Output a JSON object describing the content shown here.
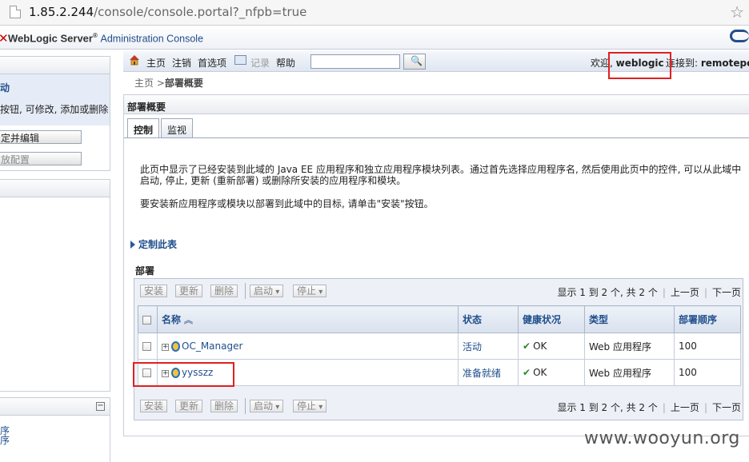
{
  "browser": {
    "url_host": "1.85.2.244",
    "url_path": "/console/console.portal?_nfpb=true"
  },
  "header": {
    "brand": "WebLogic Server",
    "brand_mark": "®",
    "subtitle": "Administration Console"
  },
  "left": {
    "change_center_title": "动",
    "change_center_text": "按钮, 可修改, 添加或删除",
    "lock_edit_button": "定并编辑",
    "release_config_button": "放配置",
    "bottom_items": [
      "序",
      "序"
    ]
  },
  "toolbar": {
    "home": "主页",
    "logout": "注销",
    "preferences": "首选项",
    "record": "记录",
    "help": "帮助",
    "search_placeholder": "",
    "welcome_prefix": "欢迎,",
    "username": "weblogic",
    "connected_prefix": "连接到:",
    "domain": "remotepc"
  },
  "breadcrumb": {
    "home": "主页",
    "sep": ">",
    "current": "部署概要"
  },
  "panel": {
    "title": "部署概要",
    "tabs": [
      {
        "label": "控制",
        "active": true
      },
      {
        "label": "监视",
        "active": false
      }
    ],
    "desc1": "此页中显示了已经安装到此域的 Java EE 应用程序和独立应用程序模块列表。通过首先选择应用程序名, 然后使用此页中的控件, 可以从此域中启动, 停止, 更新 (重新部署) 或删除所安装的应用程序和模块。",
    "desc2": "要安装新应用程序或模块以部署到此域中的目标, 请单击\"安装\"按钮。",
    "customize": "定制此表",
    "section": "部署"
  },
  "table": {
    "buttons": {
      "install": "安装",
      "update": "更新",
      "delete": "删除",
      "start": "启动",
      "stop": "停止"
    },
    "pager": {
      "text": "显示 1 到 2 个, 共 2 个",
      "prev": "上一页",
      "next": "下一页"
    },
    "columns": [
      "名称",
      "状态",
      "健康状况",
      "类型",
      "部署顺序"
    ],
    "rows": [
      {
        "name": "OC_Manager",
        "state": "活动",
        "health": "OK",
        "type": "Web 应用程序",
        "order": "100"
      },
      {
        "name": "yysszz",
        "state": "准备就绪",
        "health": "OK",
        "type": "Web 应用程序",
        "order": "100"
      }
    ]
  },
  "watermark": "www.wooyun.org",
  "colors": {
    "link": "#1f4e8c",
    "highlight_box": "#e02020",
    "ok_check": "#2a8a2a"
  }
}
